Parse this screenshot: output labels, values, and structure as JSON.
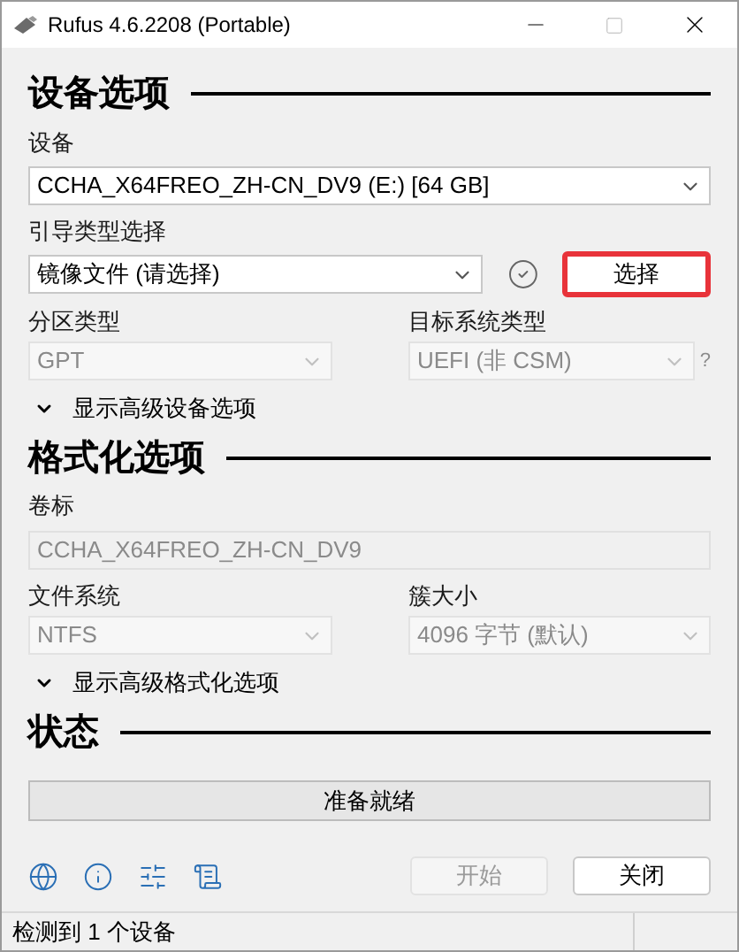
{
  "window": {
    "title": "Rufus 4.6.2208 (Portable)"
  },
  "device_section": {
    "heading": "设备选项",
    "device": {
      "label": "设备",
      "value": "CCHA_X64FREO_ZH-CN_DV9 (E:) [64 GB]",
      "disabled": false
    },
    "boot": {
      "label": "引导类型选择",
      "value": "镜像文件 (请选择)",
      "disabled": false
    },
    "select_button": {
      "label": "选择",
      "highlighted": true
    },
    "partition": {
      "label": "分区类型",
      "value": "GPT",
      "disabled": true
    },
    "target": {
      "label": "目标系统类型",
      "value": "UEFI (非 CSM)",
      "disabled": true
    },
    "target_help": "?",
    "advanced": {
      "label": "显示高级设备选项",
      "expanded": false
    }
  },
  "format_section": {
    "heading": "格式化选项",
    "volume_label": {
      "label": "卷标",
      "value": "CCHA_X64FREO_ZH-CN_DV9",
      "disabled": true
    },
    "filesystem": {
      "label": "文件系统",
      "value": "NTFS",
      "disabled": true
    },
    "cluster": {
      "label": "簇大小",
      "value": "4096 字节 (默认)",
      "disabled": true
    },
    "advanced": {
      "label": "显示高级格式化选项",
      "expanded": false
    }
  },
  "status_section": {
    "heading": "状态",
    "progress": {
      "text": "准备就绪",
      "level": 0
    }
  },
  "buttons": [
    {
      "label": "开始",
      "disabled": true
    },
    {
      "label": "关闭",
      "disabled": false
    }
  ],
  "status_bar": {
    "text": "检测到 1 个设备"
  }
}
